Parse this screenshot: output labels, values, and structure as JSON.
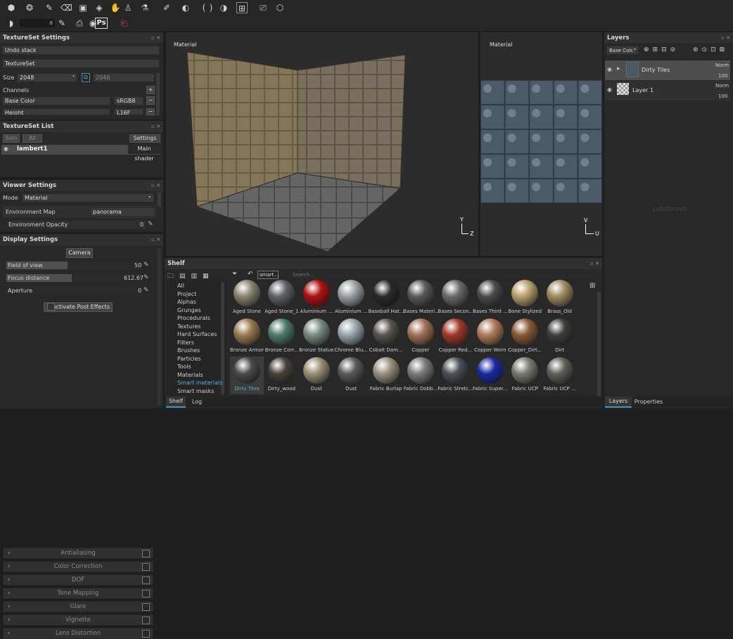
{
  "toolbar": {
    "stepper_value": "8",
    "photoshop_label": "Ps"
  },
  "textureset_settings": {
    "title": "TextureSet Settings",
    "undo_stack": "Undo stack",
    "textureset": "TextureSet",
    "size_label": "Size",
    "size_value": "2048",
    "size_value2": "2048",
    "channels_label": "Channels",
    "channel1": "Base Color",
    "channel1_format": "sRGB8",
    "channel2": "Height",
    "channel2_format": "L16F"
  },
  "textureset_list": {
    "title": "TextureSet List",
    "solo": "Solo",
    "all": "All",
    "settings": "Settings",
    "item": "lambert1",
    "shader": "Main shader"
  },
  "viewer_settings": {
    "title": "Viewer Settings",
    "mode_label": "Mode",
    "mode_value": "Material",
    "env_map_label": "Environment Map",
    "env_map_value": "panorama",
    "env_opacity_label": "Environment Opacity",
    "env_opacity_value": "0"
  },
  "display_settings": {
    "title": "Display Settings",
    "camera": "Camera",
    "fov_label": "Field of view",
    "fov_value": "50",
    "fov_fraction": 0.45,
    "focus_label": "Focus distance",
    "focus_value": "612.67",
    "focus_fraction": 0.48,
    "aperture_label": "Aperture",
    "aperture_value": "0",
    "activate_post": "Activate Post Effects",
    "effects": [
      "Antialiasing",
      "Color Correction",
      "DOF",
      "Tone Mapping",
      "Glare",
      "Vignette",
      "Lens Distortion"
    ]
  },
  "viewport3d": {
    "label": "Material",
    "axis_y": "Y",
    "axis_z": "Z"
  },
  "viewport2d": {
    "label": "Material",
    "axis_v": "V",
    "axis_u": "U"
  },
  "watermark": "cubebrush",
  "shelf": {
    "title": "Shelf",
    "filter_tag": "smart...",
    "search_placeholder": "Search...",
    "categories": [
      "All",
      "Project",
      "Alphas",
      "Grunges",
      "Procedurals",
      "Textures",
      "Hard Surfaces",
      "Filters",
      "Brushes",
      "Particles",
      "Tools",
      "Materials",
      "Smart materials",
      "Smart masks"
    ],
    "selected_category": "Smart materials",
    "materials": [
      [
        "Aged Stone",
        "Aged Stone_1",
        "Aluminium ...",
        "Aluminium ...",
        "Baseball Hat...",
        "Bases Materi...",
        "Bases Secon...",
        "Bases Third ...",
        "Bone Stylized",
        "Brass_Old"
      ],
      [
        "Bronze Armor",
        "Bronze Corr...",
        "Bronze Statue",
        "Chrome Blu...",
        "Cobalt Dam...",
        "Copper",
        "Copper Red...",
        "Copper Worn",
        "Copper_Dirt...",
        "Dirt"
      ],
      [
        "Dirty Tiles",
        "Dirty_wood",
        "Dust",
        "Dust",
        "Fabric Burlap",
        "Fabric Dobb...",
        "Fabric Stretc...",
        "Fabric Super...",
        "Fabric UCP",
        "Fabric UCP ..."
      ]
    ],
    "colors": [
      [
        "#8a8470",
        "#5e6366",
        "#b01010",
        "#9aa0a6",
        "#2a2a2a",
        "#5a5a58",
        "#6a6a68",
        "#4a4a48",
        "#b8a070",
        "#a08a60"
      ],
      [
        "#9a7a50",
        "#4e7a68",
        "#7a8a80",
        "#9aa4ac",
        "#58544c",
        "#a07058",
        "#a03a28",
        "#b07a58",
        "#8a5a38",
        "#3e3e3a"
      ],
      [
        "#4a4a4a",
        "#4a4038",
        "#9a8e76",
        "#5a5a5a",
        "#9a9080",
        "#7a7a78",
        "#4a5058",
        "#1a2aa0",
        "#7a7a70",
        "#606058"
      ]
    ],
    "tabs": [
      "Shelf",
      "Log"
    ]
  },
  "layers": {
    "title": "Layers",
    "channel": "Base Colc",
    "items": [
      {
        "name": "Dirty Tiles",
        "blend": "Norm",
        "opacity": "100"
      },
      {
        "name": "Layer 1",
        "blend": "Norm",
        "opacity": "100"
      }
    ],
    "tabs": [
      "Layers",
      "Properties"
    ]
  }
}
